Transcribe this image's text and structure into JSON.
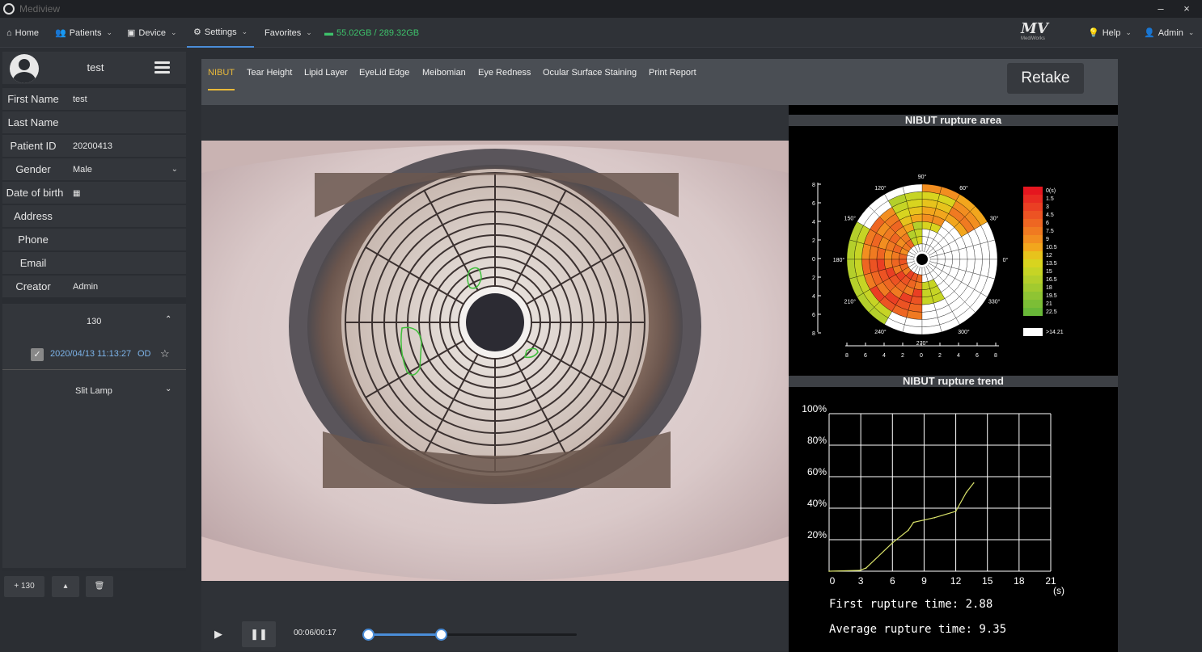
{
  "app": {
    "title": "Mediview"
  },
  "window": {
    "minimize": "–",
    "close": "×"
  },
  "nav": {
    "home": "Home",
    "patients": "Patients",
    "device": "Device",
    "settings": "Settings",
    "favorites": "Favorites",
    "storage": "55.02GB / 289.32GB",
    "brand": "MV",
    "brand_sub": "MediWorks",
    "help": "Help",
    "user": "Admin"
  },
  "patient": {
    "name": "test",
    "fields": [
      {
        "label": "First Name",
        "value": "test"
      },
      {
        "label": "Last Name",
        "value": ""
      },
      {
        "label": "Patient ID",
        "value": "20200413"
      },
      {
        "label": "Gender",
        "value": "Male"
      },
      {
        "label": "Date of birth",
        "value": ""
      },
      {
        "label": "Address",
        "value": ""
      },
      {
        "label": "Phone",
        "value": ""
      },
      {
        "label": "Email",
        "value": ""
      },
      {
        "label": "Creator",
        "value": "Admin"
      }
    ]
  },
  "records": {
    "group": "130",
    "item_date": "2020/04/13 11:13:27",
    "item_eye": "OD",
    "slit_lamp": "Slit Lamp"
  },
  "bottom": {
    "add_label": "+ 130"
  },
  "tabs": [
    "NIBUT",
    "Tear Height",
    "Lipid Layer",
    "EyeLid Edge",
    "Meibomian",
    "Eye Redness",
    "Ocular Surface Staining",
    "Print Report"
  ],
  "retake": "Retake",
  "player": {
    "time": "00:06/00:17",
    "progress_start": 0,
    "progress_current": 0.35
  },
  "rupture_area": {
    "title": "NIBUT rupture area",
    "y_ticks": [
      "8",
      "6",
      "4",
      "2",
      "0",
      "2",
      "4",
      "6",
      "8"
    ],
    "x_ticks": [
      "8",
      "6",
      "4",
      "2",
      "0",
      "2",
      "4",
      "6",
      "8"
    ],
    "angle_labels": [
      "90°",
      "60°",
      "30°",
      "0°",
      "330°",
      "300°",
      "270°",
      "240°",
      "210°",
      "180°",
      "150°",
      "120°"
    ],
    "legend": [
      "0(s)",
      "1.5",
      "3",
      "4.5",
      "6",
      "7.5",
      "9",
      "10.5",
      "12",
      "13.5",
      "15",
      "16.5",
      "18",
      "19.5",
      "21",
      "22.5"
    ],
    "legend_colors": [
      "#e5161f",
      "#e82b22",
      "#ea3f23",
      "#ec5323",
      "#ee6622",
      "#f07a21",
      "#f28e20",
      "#f2a61d",
      "#e7c31c",
      "#d8d41f",
      "#c6d425",
      "#b4cf2b",
      "#a2ca2f",
      "#8fc433",
      "#7cbe36",
      "#69b838"
    ],
    "legend_white": ">14.21"
  },
  "rupture_trend": {
    "title": "NIBUT rupture trend",
    "first_time": "First rupture time: 2.88",
    "avg_time": "Average rupture time:  9.35"
  },
  "chart_data": {
    "type": "line",
    "title": "NIBUT rupture trend",
    "xlabel": "(s)",
    "ylabel": "",
    "xlim": [
      0,
      21
    ],
    "ylim": [
      0,
      100
    ],
    "x_ticks": [
      "0",
      "3",
      "6",
      "9",
      "12",
      "15",
      "18",
      "21"
    ],
    "y_ticks": [
      "100%",
      "80%",
      "60%",
      "40%",
      "20%"
    ],
    "x": [
      0,
      2.9,
      3.5,
      6,
      7.5,
      8,
      10,
      12,
      13,
      13.7
    ],
    "values": [
      0,
      0.5,
      2,
      18,
      26,
      31,
      34,
      38,
      50,
      56
    ]
  }
}
